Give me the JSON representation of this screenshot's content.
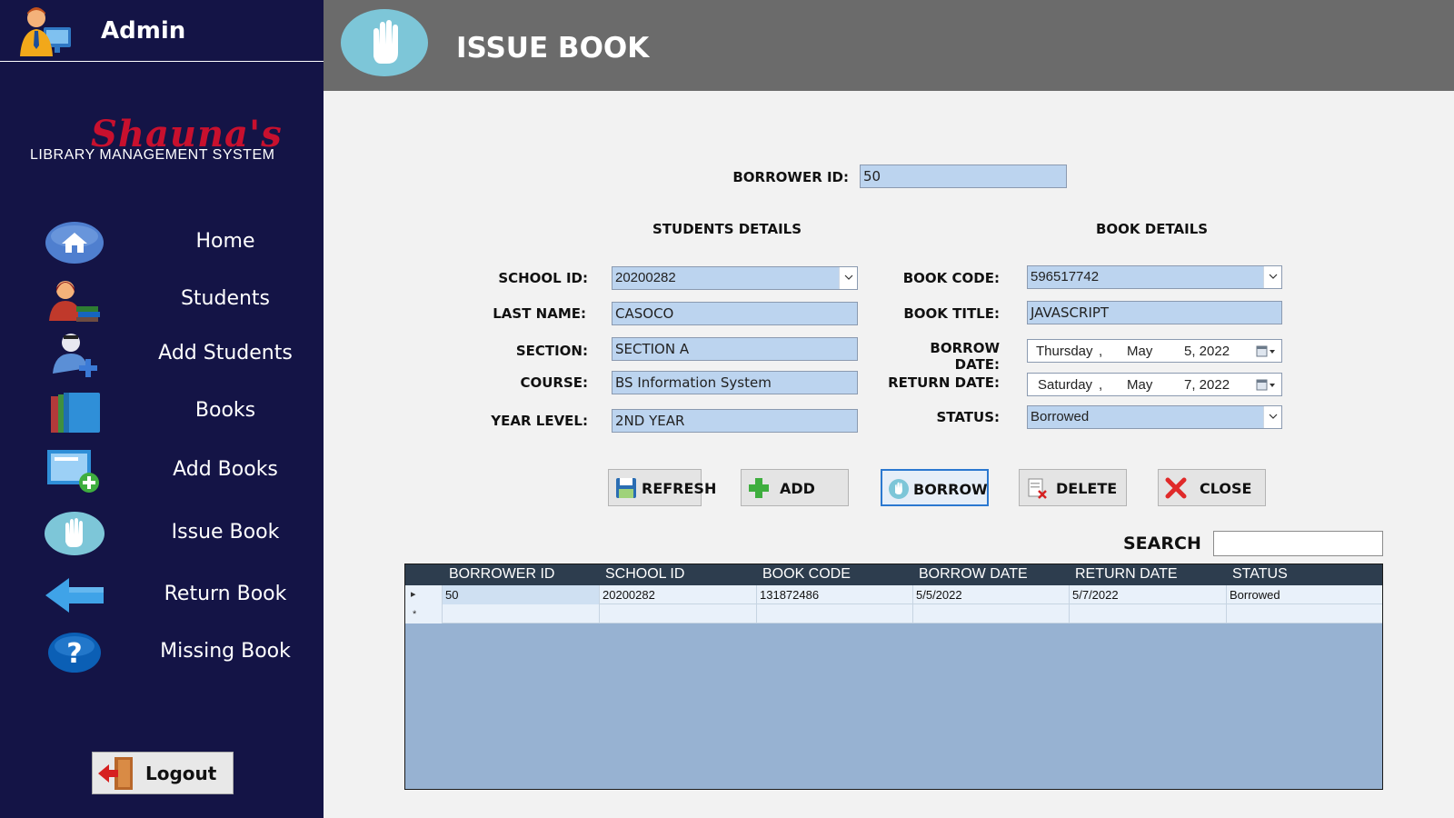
{
  "sidebar": {
    "admin_title": "Admin",
    "logo_script": "Shauna's",
    "logo_subtitle": "LIBRARY MANAGEMENT SYSTEM",
    "items": [
      {
        "label": "Home",
        "icon": "home-icon"
      },
      {
        "label": "Students",
        "icon": "students-icon"
      },
      {
        "label": "Add Students",
        "icon": "add-student-icon"
      },
      {
        "label": "Books",
        "icon": "books-icon"
      },
      {
        "label": "Add Books",
        "icon": "add-book-icon"
      },
      {
        "label": "Issue Book",
        "icon": "hand-icon"
      },
      {
        "label": "Return Book",
        "icon": "arrow-left-icon"
      },
      {
        "label": "Missing Book",
        "icon": "question-icon"
      }
    ],
    "logout_label": "Logout"
  },
  "header": {
    "title": "ISSUE BOOK",
    "icon": "hand-icon"
  },
  "form": {
    "borrower_id_label": "BORROWER ID:",
    "borrower_id_value": "50",
    "students_details_heading": "STUDENTS DETAILS",
    "book_details_heading": "BOOK DETAILS",
    "school_id_label": "SCHOOL ID:",
    "school_id_value": "20200282",
    "last_name_label": "LAST NAME:",
    "last_name_value": "CASOCO",
    "section_label": "SECTION:",
    "section_value": "SECTION A",
    "course_label": "COURSE:",
    "course_value": "BS Information System",
    "year_level_label": "YEAR LEVEL:",
    "year_level_value": "2ND YEAR",
    "book_code_label": "BOOK CODE:",
    "book_code_value": "596517742",
    "book_title_label": "BOOK TITLE:",
    "book_title_value": "JAVASCRIPT",
    "borrow_date_label": "BORROW DATE:",
    "borrow_date": {
      "weekday": "Thursday",
      "sep": ",",
      "month": "May",
      "day_year": "5, 2022"
    },
    "return_date_label": "RETURN DATE:",
    "return_date": {
      "weekday": "Saturday",
      "sep": ",",
      "month": "May",
      "day_year": "7, 2022"
    },
    "status_label": "STATUS:",
    "status_value": "Borrowed"
  },
  "buttons": {
    "refresh": "REFRESH",
    "add": "ADD",
    "borrow": "BORROW",
    "delete": "DELETE",
    "close": "CLOSE"
  },
  "search": {
    "label": "SEARCH",
    "value": ""
  },
  "grid": {
    "columns": [
      "BORROWER ID",
      "SCHOOL ID",
      "BOOK CODE",
      "BORROW DATE",
      "RETURN DATE",
      "STATUS"
    ],
    "rows": [
      {
        "marker": "▸",
        "cells": [
          "50",
          "20200282",
          "131872486",
          "5/5/2022",
          "5/7/2022",
          "Borrowed"
        ]
      },
      {
        "marker": "*",
        "cells": [
          "",
          "",
          "",
          "",
          "",
          ""
        ]
      }
    ]
  },
  "colors": {
    "sidebar_bg": "#141446",
    "header_bg": "#6b6b6b",
    "field_bg": "#bcd4ef",
    "grid_header_bg": "#2d3d4e",
    "grid_empty_bg": "#97b2d2",
    "logo_red": "#c8102e"
  }
}
